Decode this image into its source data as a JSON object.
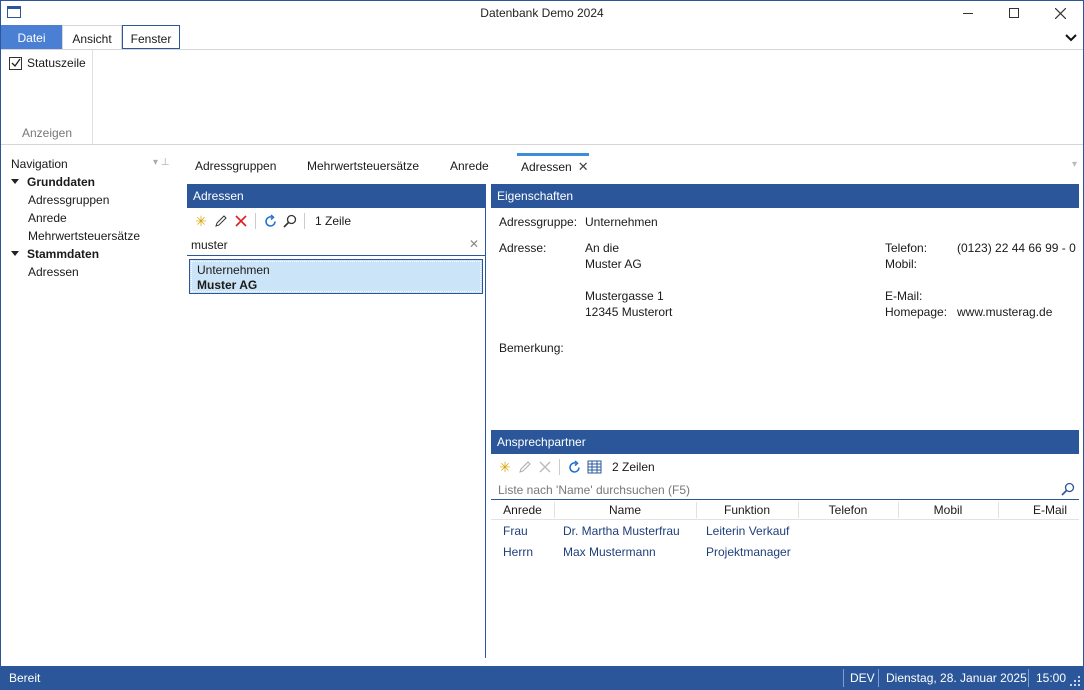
{
  "window": {
    "title": "Datenbank Demo 2024"
  },
  "ribbon": {
    "tabs": [
      "Datei",
      "Ansicht",
      "Fenster"
    ],
    "statuszeile_label": "Statuszeile",
    "statuszeile_checked": true,
    "group_label": "Anzeigen"
  },
  "navigation": {
    "header": "Navigation",
    "groups": [
      {
        "label": "Grunddaten",
        "items": [
          "Adressgruppen",
          "Anrede",
          "Mehrwertsteuersätze"
        ]
      },
      {
        "label": "Stammdaten",
        "items": [
          "Adressen"
        ]
      }
    ]
  },
  "doc_tabs": [
    "Adressgruppen",
    "Mehrwertsteuersätze",
    "Anrede",
    "Adressen"
  ],
  "active_tab": "Adressen",
  "adressen": {
    "header": "Adressen",
    "row_count": "1 Zeile",
    "search_value": "muster",
    "results": [
      {
        "group": "Unternehmen",
        "name": "Muster AG"
      }
    ]
  },
  "eigenschaften": {
    "header": "Eigenschaften",
    "adressgruppe_label": "Adressgruppe:",
    "adressgruppe_value": "Unternehmen",
    "adresse_label": "Adresse:",
    "adresse_line1": "An die",
    "adresse_line2": "Muster AG",
    "adresse_line3": "Mustergasse 1",
    "adresse_line4": "12345 Musterort",
    "telefon_label": "Telefon:",
    "telefon_value": "(0123) 22 44 66 99 - 0",
    "mobil_label": "Mobil:",
    "email_label": "E-Mail:",
    "homepage_label": "Homepage:",
    "homepage_value": "www.musterag.de",
    "bemerkung_label": "Bemerkung:"
  },
  "ansprechpartner": {
    "header": "Ansprechpartner",
    "row_count": "2 Zeilen",
    "search_placeholder": "Liste nach 'Name' durchsuchen (F5)",
    "columns": [
      "Anrede",
      "Name",
      "Funktion",
      "Telefon",
      "Mobil",
      "E-Mail"
    ],
    "rows": [
      {
        "anrede": "Frau",
        "name": "Dr. Martha Musterfrau",
        "funktion": "Leiterin Verkauf"
      },
      {
        "anrede": "Herrn",
        "name": "Max Mustermann",
        "funktion": "Projektmanager"
      }
    ]
  },
  "statusbar": {
    "left": "Bereit",
    "env": "DEV",
    "date": "Dienstag, 28. Januar 2025",
    "time": "15:00"
  },
  "colors": {
    "accent": "#2b579a",
    "file_tab": "#4a7fd4",
    "selection": "#cce4f7",
    "active_tab_line": "#3b8fd6"
  }
}
